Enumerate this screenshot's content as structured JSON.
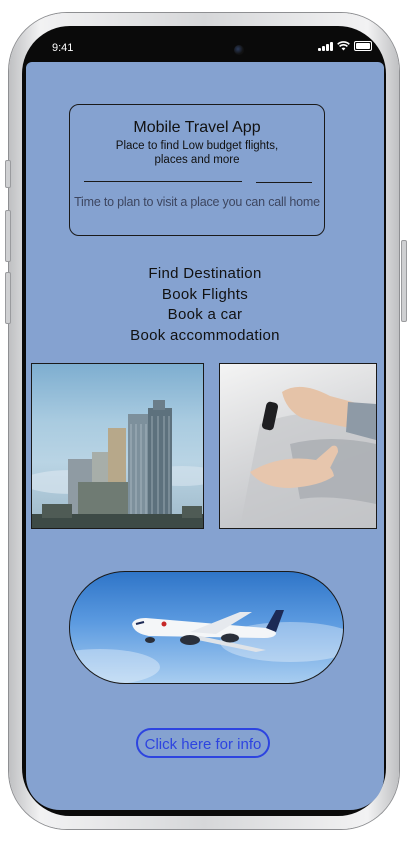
{
  "status_bar": {
    "time": "9:41",
    "icons": [
      "cellular-signal-icon",
      "wifi-icon",
      "battery-icon"
    ]
  },
  "header_card": {
    "title": "Mobile Travel App",
    "subtitle_line1": "Place to find Low budget flights,",
    "subtitle_line2": "places and more",
    "tagline": "Time to plan to visit a place you can call home"
  },
  "menu": {
    "items": [
      {
        "label": "Find Destination"
      },
      {
        "label": "Book Flights"
      },
      {
        "label": "Book a car"
      },
      {
        "label": "Book accommodation"
      }
    ]
  },
  "images": {
    "city": "city-skyline-photo",
    "car_keys": "car-key-handover-photo",
    "airplane": "airplane-in-sky-photo"
  },
  "info_button": {
    "label": "Click here for info"
  },
  "colors": {
    "screen_background": "#85a2d0",
    "button_accent": "#2d44e0",
    "text": "#111111"
  }
}
